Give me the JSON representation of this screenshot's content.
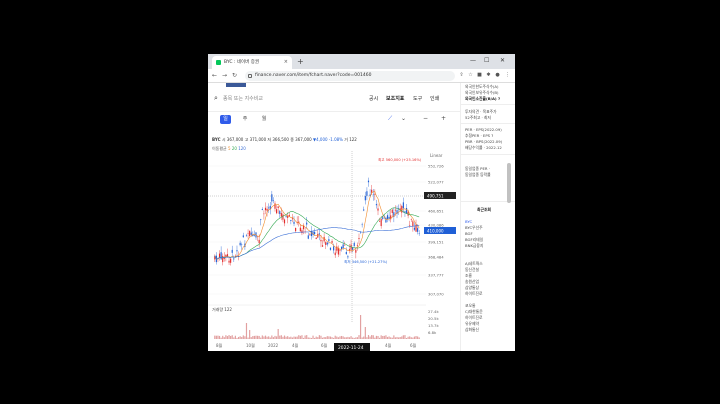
{
  "browser": {
    "tab_title": "BYC : 네이버 증권",
    "url": "finance.naver.com/item/fchart.naver?code=001460",
    "new_tab": "+",
    "minimize": "—",
    "maximize": "☐",
    "close": "✕",
    "tab_close": "×"
  },
  "search": {
    "placeholder": "종목 또는 지수비교"
  },
  "menu": {
    "items": [
      "공시",
      "보조지표",
      "도구",
      "인쇄"
    ]
  },
  "periods": [
    "일",
    "주",
    "월"
  ],
  "stock_info": {
    "name": "BYC",
    "open_label": "시",
    "open": "367,000",
    "high_label": "고",
    "high": "371,000",
    "low_label": "저",
    "low": "366,500",
    "close_label": "종",
    "close": "367,000",
    "change": "▼4,000",
    "change_pct": "-1.08%",
    "volume_label": "거",
    "volume": "122"
  },
  "ma_row": {
    "label": "이동평균",
    "ma1": "5",
    "ma2": "20",
    "ma3": "120"
  },
  "chart": {
    "scale_label": "Linear",
    "max_annotation": "최고 560,000 (+25.16%)",
    "min_annotation": "최저 346,500 (+21.27%)",
    "y_ticks": [
      "552,726",
      "522,077",
      "460,651",
      "430,086",
      "399,151",
      "368,484",
      "337,777",
      "307,070"
    ],
    "current_price": "490,751",
    "last_price": "410,000",
    "volume_label": "거래량 122",
    "vol_ticks": [
      "27.4k",
      "20.5k",
      "13.7k",
      "6.8k"
    ],
    "x_ticks": [
      "8월",
      "10월",
      "2022",
      "4월",
      "6월",
      "2022",
      "4월",
      "6월"
    ],
    "crosshair_date": "2022-11-24"
  },
  "sidebar": {
    "lines": [
      "외국인한도주식수(A)",
      "외국인보유주식수(B)",
      "외국인소진율(B/A) ?",
      "투자의견 · 목표주가",
      "52주최고 · 최저",
      "PER · EPS(2022.09)",
      "추정PER · EPS ?",
      "PBR · BPS(2022.09)",
      "배당수익률 · 2022.12",
      "동일업종 PER ·",
      "동일업종 등락률"
    ],
    "recent_title": "최근조회",
    "recent": [
      "BYC",
      "BYC우선주",
      "BGF",
      "BGF리테일",
      "BNK금융지"
    ],
    "related": [
      "AJ네트웍스",
      "동신건설",
      "조흥",
      "송원산업",
      "삼양통상",
      "하이트진로"
    ],
    "related2": [
      "코오롱",
      "CJ대한통운",
      "하이트진로",
      "유유제약",
      "삼화통신"
    ]
  },
  "colors": {
    "accent": "#2f5bea",
    "up": "#e22d2d",
    "down": "#1f5fd6",
    "ma1": "#f08a2a",
    "ma2": "#32a852",
    "ma3": "#3b6fd6"
  }
}
